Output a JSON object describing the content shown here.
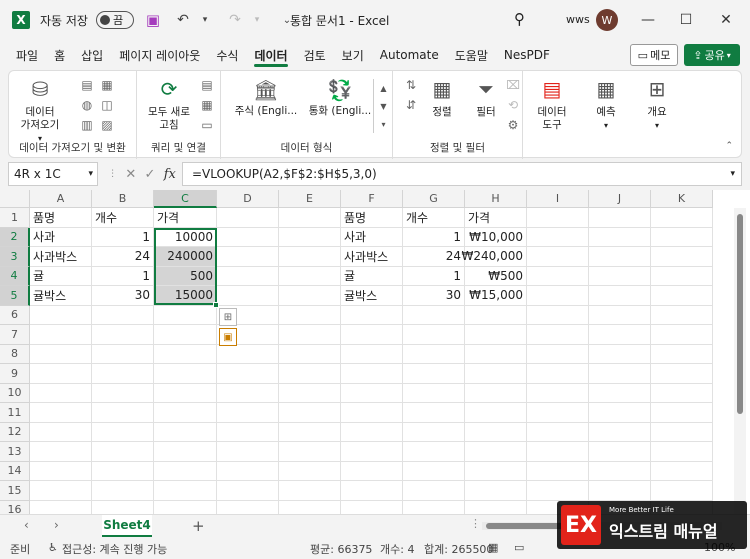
{
  "titlebar": {
    "autosave_label": "자동 저장",
    "toggle_state": "끔",
    "doc_title": "통합 문서1  -  Excel",
    "username": "wws",
    "avatar_initial": "W"
  },
  "menu": {
    "tabs": [
      "파일",
      "홈",
      "삽입",
      "페이지 레이아웃",
      "수식",
      "데이터",
      "검토",
      "보기",
      "Automate",
      "도움말",
      "NesPDF"
    ],
    "active_tab": "데이터",
    "memo_label": "메모",
    "share_label": "공유"
  },
  "ribbon": {
    "get_data_label": "데이터\n가져오기",
    "get_data_group": "데이터 가져오기 및 변환",
    "refresh_all_label": "모두 새로\n고침",
    "queries_group": "쿼리 및 연결",
    "stocks_label": "주식 (Engli...",
    "currency_label": "통화 (Engli...",
    "data_types_group": "데이터 형식",
    "sort_label": "정렬",
    "filter_label": "필터",
    "sort_filter_group": "정렬 및 필터",
    "data_tools_label": "데이터\n도구",
    "forecast_label": "예측",
    "outline_label": "개요"
  },
  "formula_bar": {
    "name_box": "4R x 1C",
    "fx": "fx",
    "formula": "=VLOOKUP(A2,$F$2:$H$5,3,0)"
  },
  "grid": {
    "columns": [
      "A",
      "B",
      "C",
      "D",
      "E",
      "F",
      "G",
      "H",
      "I",
      "J",
      "K"
    ],
    "rows": [
      "1",
      "2",
      "3",
      "4",
      "5",
      "6",
      "7",
      "8",
      "9",
      "10",
      "11",
      "12",
      "13",
      "14",
      "15",
      "16"
    ],
    "left_table": {
      "headers": [
        "품명",
        "개수",
        "가격"
      ],
      "rows": [
        [
          "사과",
          "1",
          "10000"
        ],
        [
          "사과박스",
          "24",
          "240000"
        ],
        [
          "귤",
          "1",
          "500"
        ],
        [
          "귤박스",
          "30",
          "15000"
        ]
      ]
    },
    "right_table": {
      "headers": [
        "품명",
        "개수",
        "가격"
      ],
      "rows": [
        [
          "사과",
          "1",
          "₩10,000"
        ],
        [
          "사과박스",
          "24",
          "₩240,000"
        ],
        [
          "귤",
          "1",
          "₩500"
        ],
        [
          "귤박스",
          "30",
          "₩15,000"
        ]
      ]
    },
    "selected_column": "C",
    "selected_rows": [
      "2",
      "3",
      "4",
      "5"
    ]
  },
  "sheets": {
    "tabs": [
      "Sheet4"
    ],
    "active": "Sheet4"
  },
  "status": {
    "ready": "준비",
    "accessibility": "접근성: 계속 진행 가능",
    "average": "평균: 66375",
    "count": "개수: 4",
    "sum": "합계: 265500",
    "zoom": "100%"
  },
  "watermark": {
    "small": "More Better IT Life",
    "big": "익스트림 매뉴얼"
  },
  "colors": {
    "accent": "#107c41",
    "selection": "#d4d4d4"
  }
}
